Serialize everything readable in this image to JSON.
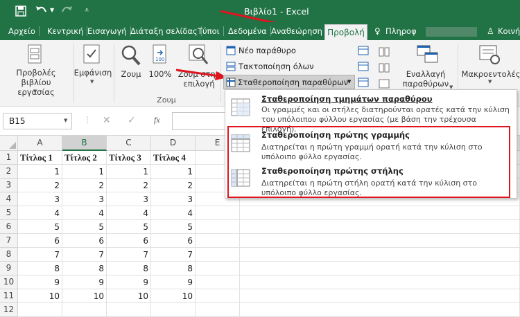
{
  "title": {
    "window_title": "Βιβλίο1 - Excel"
  },
  "tabs": [
    {
      "label": "Αρχείο"
    },
    {
      "label": "Κεντρική"
    },
    {
      "label": "Εισαγωγή"
    },
    {
      "label": "Διάταξη σελίδας"
    },
    {
      "label": "Τύποι"
    },
    {
      "label": "Δεδομένα"
    },
    {
      "label": "Αναθεώρηση"
    },
    {
      "label": "Προβολή"
    },
    {
      "label": "Πληροφ"
    },
    {
      "label": "Κοινή"
    }
  ],
  "ribbon": {
    "workbook_views": "Προβολές βιβλίου εργασίας",
    "show": "Εμφάνιση",
    "zoom": "Ζουμ",
    "zoom100": "100%",
    "zoom_selection": "Ζουμ στην επιλογή",
    "zoom_group": "Ζουμ",
    "new_window": "Νέο παράθυρο",
    "arrange_all": "Τακτοποίηση όλων",
    "freeze_panes": "Σταθεροποίηση παραθύρων",
    "switch_windows": "Εναλλαγή παραθύρων",
    "macros": "Μακροεντολές"
  },
  "formula": {
    "name_box": "B15",
    "fx": "fx"
  },
  "menu": {
    "item1_title": "Σταθεροποίηση τμημάτων παραθύρου",
    "item1_desc": "Οι γραμμές και οι στήλες διατηρούνται ορατές κατά την κύλιση του υπόλοιπου φύλλου εργασίας (με βάση την τρέχουσα επιλογή).",
    "item2_title": "Σταθεροποίηση πρώτης γραμμής",
    "item2_desc": "Διατηρείται η πρώτη γραμμή ορατή κατά την κύλιση στο υπόλοιπο φύλλο εργασίας.",
    "item3_title": "Σταθεροποίηση πρώτης στήλης",
    "item3_desc": "Διατηρείται η πρώτη στήλη ορατή κατά την κύλιση στο υπόλοιπο φύλλο εργασίας."
  },
  "sheet": {
    "columns": [
      "A",
      "B",
      "C",
      "D",
      "E"
    ],
    "rows": [
      "1",
      "2",
      "3",
      "4",
      "5",
      "6",
      "7",
      "8",
      "9",
      "10",
      "11",
      "12"
    ],
    "headers": [
      "Τίτλος 1",
      "Τίτλος 2",
      "Τίτλος 3",
      "Τίτλος 4"
    ],
    "values": [
      [
        "1",
        "1",
        "1",
        "1"
      ],
      [
        "2",
        "2",
        "2",
        "2"
      ],
      [
        "3",
        "3",
        "3",
        "3"
      ],
      [
        "4",
        "4",
        "4",
        "4"
      ],
      [
        "5",
        "5",
        "5",
        "5"
      ],
      [
        "6",
        "6",
        "6",
        "6"
      ],
      [
        "7",
        "7",
        "7",
        "7"
      ],
      [
        "8",
        "8",
        "8",
        "8"
      ],
      [
        "9",
        "9",
        "9",
        "9"
      ],
      [
        "10",
        "10",
        "10",
        "10"
      ]
    ]
  },
  "colors": {
    "excel_green": "#217346",
    "annotation_red": "#e0141e"
  }
}
